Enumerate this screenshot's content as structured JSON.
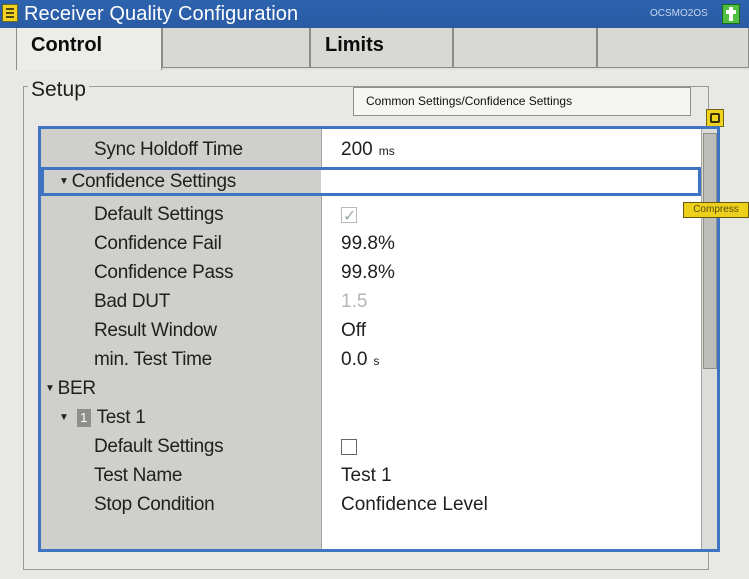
{
  "window": {
    "title": "Receiver Quality Configuration",
    "code": "OCSMO2OS"
  },
  "tabs": [
    {
      "label": "Control",
      "active": true
    },
    {
      "label": "",
      "active": false
    },
    {
      "label": "Limits",
      "active": false
    },
    {
      "label": "",
      "active": false
    },
    {
      "label": "",
      "active": false
    }
  ],
  "setup": {
    "label": "Setup",
    "common_settings": "Common Settings/Confidence Settings",
    "compress_label": "Compress"
  },
  "rows": [
    {
      "name": "Sync Holdoff Time",
      "value": "200",
      "unit": "ms"
    },
    {
      "name": "Confidence Settings",
      "value": ""
    },
    {
      "name": "Default Settings",
      "value": ""
    },
    {
      "name": "Confidence Fail",
      "value": "99.8%"
    },
    {
      "name": "Confidence Pass",
      "value": "99.8%"
    },
    {
      "name": "Bad DUT",
      "value": "1.5"
    },
    {
      "name": "Result Window",
      "value": "Off"
    },
    {
      "name": "min. Test Time",
      "value": "0.0",
      "unit": "s"
    },
    {
      "name": "BER",
      "value": ""
    },
    {
      "name": "Test 1",
      "badge": "1",
      "value": ""
    },
    {
      "name": "Default Settings",
      "value": ""
    },
    {
      "name": "Test Name",
      "value": "Test 1"
    },
    {
      "name": "Stop Condition",
      "value": "Confidence Level"
    }
  ],
  "colors": {
    "title_bar": "#2a5ca5",
    "selection_border": "#3f74c2",
    "accent_yellow": "#f1d21c",
    "title_button_green": "#51bf44"
  }
}
